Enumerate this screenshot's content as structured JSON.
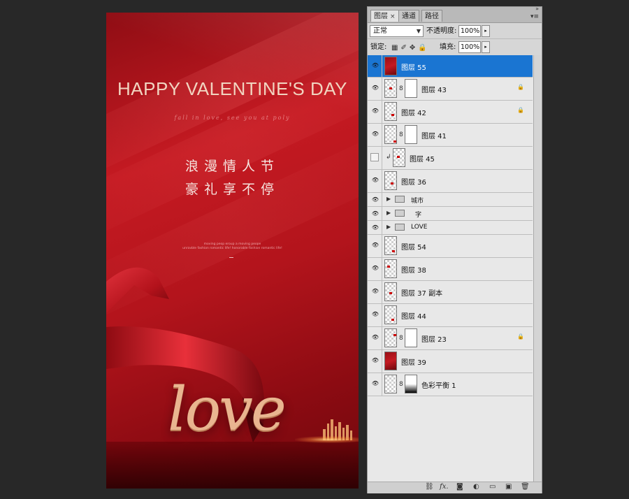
{
  "canvas": {
    "title": "HAPPY VALENTINE'S DAY",
    "tagline": "fall in love, see you at poly",
    "cn_line1": "浪漫情人节",
    "cn_line2": "豪礼享不停",
    "small_line1": "moving peop eroup a moving peope",
    "small_line2": "unravble fashion romantic life! honorable fashion romantic life!",
    "dash": "—",
    "love": "love"
  },
  "panel": {
    "tabs": [
      {
        "label": "图层",
        "close": "×"
      },
      {
        "label": "通道"
      },
      {
        "label": "路径"
      }
    ],
    "menu_icon": "▾≡",
    "collapse_icon": "»",
    "blend_mode": "正常",
    "opacity_label": "不透明度:",
    "opacity_value": "100%",
    "lock_label": "锁定:",
    "fill_label": "填充:",
    "fill_value": "100%",
    "stepper": "▸"
  },
  "layers": [
    {
      "name": "图层 55",
      "thumb": "red",
      "selected": true,
      "visible": true
    },
    {
      "name": "图层 43",
      "thumb": "trans",
      "mask": true,
      "lock": true,
      "visible": true
    },
    {
      "name": "图层 42",
      "thumb": "trans",
      "lock": true,
      "visible": true
    },
    {
      "name": "图层 41",
      "thumb": "trans",
      "mask": true,
      "visible": true
    },
    {
      "name": "图层 45",
      "thumb": "trans",
      "clipped": true,
      "visible": false
    },
    {
      "name": "图层 36",
      "thumb": "trans",
      "visible": true
    },
    {
      "name": "城市",
      "group": true,
      "visible": true
    },
    {
      "name": "字",
      "group": true,
      "visible": true
    },
    {
      "name": "LOVE",
      "group": true,
      "visible": true
    },
    {
      "name": "图层 54",
      "thumb": "trans",
      "visible": true
    },
    {
      "name": "图层 38",
      "thumb": "trans",
      "visible": true
    },
    {
      "name": "图层 37 副本",
      "thumb": "trans",
      "visible": true
    },
    {
      "name": "图层 44",
      "thumb": "trans",
      "visible": true
    },
    {
      "name": "图层 23",
      "thumb": "trans",
      "mask": true,
      "lock": true,
      "visible": true
    },
    {
      "name": "图层 39",
      "thumb": "red",
      "visible": true
    },
    {
      "name": "色彩平衡 1",
      "thumb": "trans",
      "adjust": true,
      "visible": true
    }
  ],
  "bottom_icons": [
    "link-icon",
    "fx-icon",
    "mask-icon",
    "adjustment-icon",
    "folder-icon",
    "new-layer-icon",
    "trash-icon"
  ],
  "icon_glyphs": {
    "eye": "👁",
    "lock": "🔒",
    "chain": "8",
    "clip": "↲",
    "triangle": "▶",
    "lock_icons": "▦✐✥🔒",
    "link": "⛓",
    "fx": "fx.",
    "mask": "◙",
    "adjust": "◐",
    "folder": "▭",
    "new": "▣",
    "trash": "🗑"
  },
  "colors": {
    "selected_row": "#1a75d2",
    "canvas_red": "#c51a22",
    "background": "#282828"
  }
}
